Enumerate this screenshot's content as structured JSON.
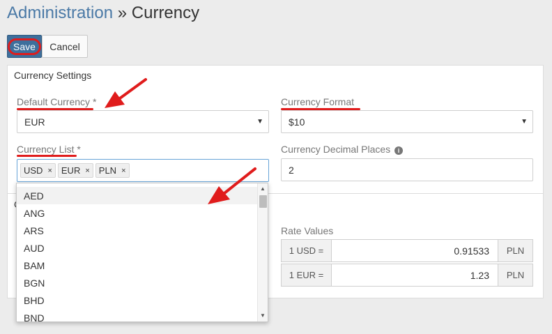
{
  "breadcrumb": {
    "parent": "Administration",
    "separator": "»",
    "current": "Currency"
  },
  "toolbar": {
    "save_label": "Save",
    "cancel_label": "Cancel"
  },
  "currency_settings": {
    "title": "Currency Settings",
    "default_currency": {
      "label": "Default Currency",
      "required": "*",
      "value": "EUR"
    },
    "currency_format": {
      "label": "Currency Format",
      "value": "$10"
    },
    "currency_list": {
      "label": "Currency List",
      "required": "*",
      "tags": [
        "USD",
        "EUR",
        "PLN"
      ],
      "remove_glyph": "×",
      "dropdown_options": [
        "AED",
        "ANG",
        "ARS",
        "AUD",
        "BAM",
        "BGN",
        "BHD",
        "BND"
      ],
      "highlighted_option": "AED"
    },
    "decimal_places": {
      "label": "Currency Decimal Places",
      "value": "2",
      "icon": "info-circle-icon"
    }
  },
  "conversion": {
    "title_partial": "C",
    "rate_values_label": "Rate Values",
    "rates": [
      {
        "from": "1 USD =",
        "value": "0.91533",
        "to": "PLN"
      },
      {
        "from": "1 EUR =",
        "value": "1.23",
        "to": "PLN"
      }
    ]
  },
  "icons": {
    "caret": "▼",
    "scroll_up": "▲",
    "scroll_down": "▼",
    "info": "i"
  },
  "colors": {
    "primary": "#3e6f9c",
    "link": "#4a79a6",
    "annotation_red": "#e01c1c",
    "focus_border": "#66a3d7"
  }
}
